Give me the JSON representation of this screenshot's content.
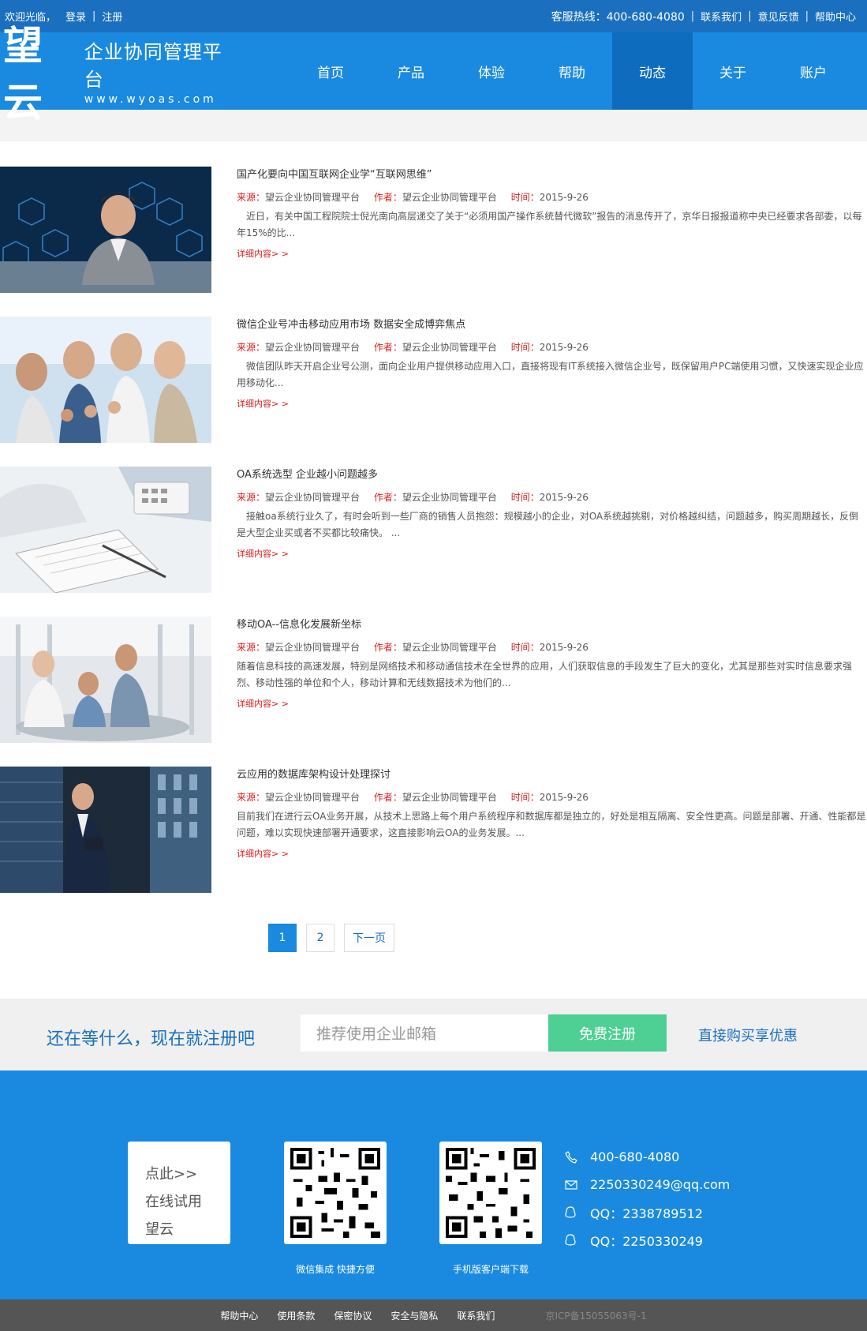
{
  "topbar": {
    "welcome": "欢迎光临，",
    "login": "登录",
    "sep": "|",
    "register": "注册",
    "hotline_label": "客服热线：",
    "hotline": "400-680-4080",
    "contact": "联系我们",
    "feedback": "意见反馈",
    "help": "帮助中心"
  },
  "brand": {
    "logo_big": "望云",
    "name": "企业协同管理平台",
    "url": "www.wyoas.com"
  },
  "nav": [
    {
      "label": "首页"
    },
    {
      "label": "产品"
    },
    {
      "label": "体验"
    },
    {
      "label": "帮助"
    },
    {
      "label": "动态",
      "active": true
    },
    {
      "label": "关于"
    },
    {
      "label": "账户"
    }
  ],
  "news": [
    {
      "title": "国产化要向中国互联网企业学“互联网思维”",
      "source_label": "来源：",
      "source": "望云企业协同管理平台",
      "author_label": "作者：",
      "author": "望云企业协同管理平台",
      "time_label": "时间：",
      "time": "2015-9-26",
      "summary": "　近日，有关中国工程院院士倪光南向高层递交了关于“必须用国产操作系统替代微软”报告的消息传开了，京华日报报道称中央已经要求各部委，以每年15%的比...",
      "more": "详细内容> >"
    },
    {
      "title": "微信企业号冲击移动应用市场 数据安全成博弈焦点",
      "source_label": "来源：",
      "source": "望云企业协同管理平台",
      "author_label": "作者：",
      "author": "望云企业协同管理平台",
      "time_label": "时间：",
      "time": "2015-9-26",
      "summary": "　微信团队昨天开启企业号公测，面向企业用户提供移动应用入口，直接将现有IT系统接入微信企业号，既保留用户PC端使用习惯，又快速实现企业应用移动化...",
      "more": "详细内容> >"
    },
    {
      "title": "OA系统选型 企业越小问题越多",
      "source_label": "来源：",
      "source": "望云企业协同管理平台",
      "author_label": "作者：",
      "author": "望云企业协同管理平台",
      "time_label": "时间：",
      "time": "2015-9-26",
      "summary": "　接触oa系统行业久了，有时会听到一些厂商的销售人员抱怨：规模越小的企业，对OA系统越挑剔，对价格越纠结，问题越多，购买周期越长，反倒是大型企业买或者不买都比较痛快。 ...",
      "more": "详细内容> >"
    },
    {
      "title": "移动OA--信息化发展新坐标",
      "source_label": "来源：",
      "source": "望云企业协同管理平台",
      "author_label": "作者：",
      "author": "望云企业协同管理平台",
      "time_label": "时间：",
      "time": "2015-9-26",
      "summary": "随着信息科技的高速发展，特别是网络技术和移动通信技术在全世界的应用，人们获取信息的手段发生了巨大的变化，尤其是那些对实时信息要求强烈、移动性强的单位和个人，移动计算和无线数据技术为他们的...",
      "more": "详细内容> >"
    },
    {
      "title": "云应用的数据库架构设计处理探讨",
      "source_label": "来源：",
      "source": "望云企业协同管理平台",
      "author_label": "作者：",
      "author": "望云企业协同管理平台",
      "time_label": "时间：",
      "time": "2015-9-26",
      "summary": "目前我们在进行云OA业务开展，从技术上思路上每个用户系统程序和数据库都是独立的，好处是相互隔离、安全性更高。问题是部署、开通、性能都是问题，难以实现快速部署开通要求，这直接影响云OA的业务发展。...",
      "more": "详细内容> >"
    }
  ],
  "pager": {
    "p1": "1",
    "p2": "2",
    "next": "下一页"
  },
  "signup": {
    "slogan": "还在等什么，现在就注册吧",
    "email_placeholder": "推荐使用企业邮箱",
    "button": "免费注册",
    "buy": "直接购买享优惠"
  },
  "footer": {
    "trial_lines": [
      "点此>>",
      "在线试用",
      "望云"
    ],
    "qr1_caption": "微信集成 快捷方便",
    "qr2_caption": "手机版客户端下载",
    "phone": "400-680-4080",
    "email": "2250330249@qq.com",
    "qq1": "QQ：2338789512",
    "qq2": "QQ：2250330249"
  },
  "bottom": {
    "links": [
      "帮助中心",
      "使用条款",
      "保密协议",
      "安全与隐私",
      "联系我们"
    ],
    "icp": "京ICP备15055063号-1"
  },
  "colors": {
    "topbar": "#1a6fbf",
    "header": "#1a8ae0",
    "nav_active": "#0e6cbf",
    "accent_red": "#d92020",
    "signup_green": "#4ecf93",
    "bottom_bar": "#555555"
  }
}
